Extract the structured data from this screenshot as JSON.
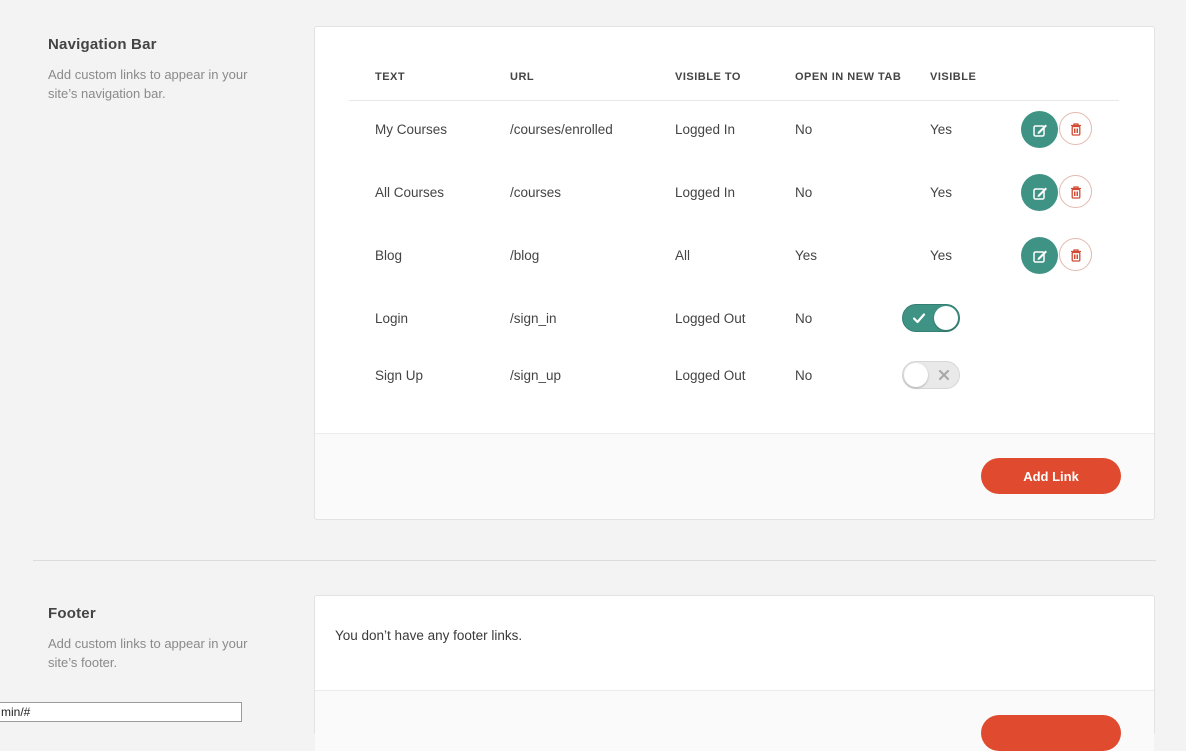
{
  "nav_section": {
    "title": "Navigation Bar",
    "description": "Add custom links to appear in your site’s navigation bar."
  },
  "table": {
    "headers": {
      "text": "TEXT",
      "url": "URL",
      "visible_to": "VISIBLE TO",
      "open_new_tab": "OPEN IN NEW TAB",
      "visible": "VISIBLE"
    },
    "rows": [
      {
        "text": "My Courses",
        "url": "/courses/enrolled",
        "visible_to": "Logged In",
        "new_tab": "No",
        "visible": "Yes"
      },
      {
        "text": "All Courses",
        "url": "/courses",
        "visible_to": "Logged In",
        "new_tab": "No",
        "visible": "Yes"
      },
      {
        "text": "Blog",
        "url": "/blog",
        "visible_to": "All",
        "new_tab": "Yes",
        "visible": "Yes"
      },
      {
        "text": "Login",
        "url": "/sign_in",
        "visible_to": "Logged Out",
        "new_tab": "No",
        "visible_toggle": true
      },
      {
        "text": "Sign Up",
        "url": "/sign_up",
        "visible_to": "Logged Out",
        "new_tab": "No",
        "visible_toggle": false
      }
    ]
  },
  "add_link_label": "Add Link",
  "footer_section": {
    "title": "Footer",
    "description": "Add custom links to appear in your site’s footer.",
    "empty_message": "You don’t have any footer links."
  },
  "status_url": "min/#",
  "icons": {
    "edit": "edit-icon",
    "delete": "trash-icon",
    "toggle_on": "check-icon",
    "toggle_off": "x-icon"
  },
  "colors": {
    "teal": "#3f9384",
    "orange": "#e04a2f",
    "delete_outline": "#e3b9ae"
  }
}
